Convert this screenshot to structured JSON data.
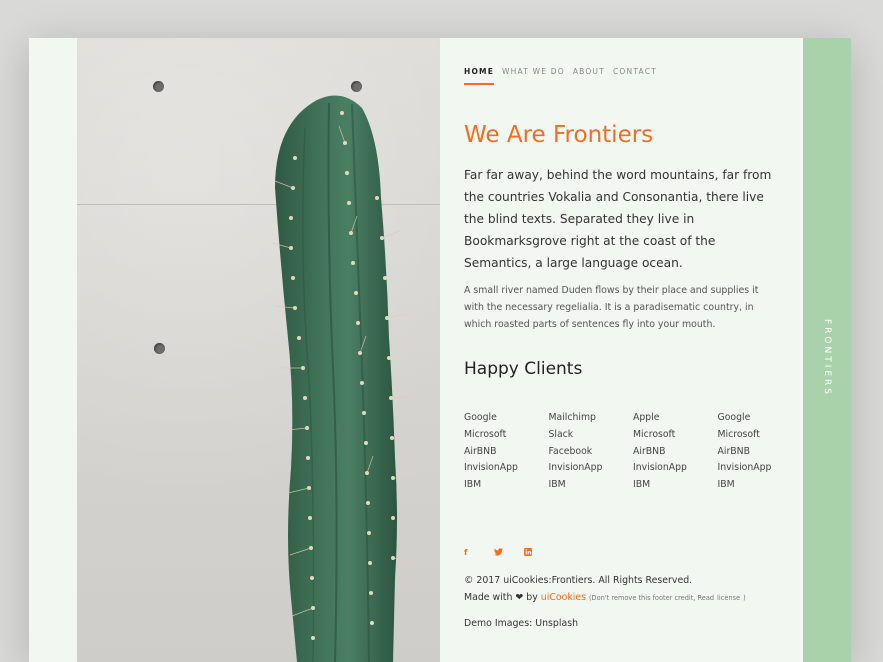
{
  "nav": {
    "items": [
      {
        "label": "HOME",
        "active": true
      },
      {
        "label": "WHAT WE DO",
        "active": false
      },
      {
        "label": "ABOUT",
        "active": false
      },
      {
        "label": "CONTACT",
        "active": false
      }
    ]
  },
  "hero": {
    "title": "We Are Frontiers",
    "lead": "Far far away, behind the word mountains, far from the countries Vokalia and Consonantia, there live the blind texts. Separated they live in Bookmarksgrove right at the coast of the Semantics, a large language ocean.",
    "body": "A small river named Duden flows by their place and supplies it with the necessary regelialia. It is a paradisematic country, in which roasted parts of sentences fly into your mouth."
  },
  "clients": {
    "heading": "Happy Clients",
    "columns": [
      [
        "Google",
        "Microsoft",
        "AirBNB",
        "InvisionApp",
        "IBM"
      ],
      [
        "Mailchimp",
        "Slack",
        "Facebook",
        "InvisionApp",
        "IBM"
      ],
      [
        "Apple",
        "Microsoft",
        "AirBNB",
        "InvisionApp",
        "IBM"
      ],
      [
        "Google",
        "Microsoft",
        "AirBNB",
        "InvisionApp",
        "IBM"
      ]
    ]
  },
  "social": {
    "icons": [
      {
        "name": "facebook-icon",
        "glyph": "f"
      },
      {
        "name": "twitter-icon",
        "glyph": "🐦"
      },
      {
        "name": "linkedin-icon",
        "glyph": "in"
      }
    ]
  },
  "footer": {
    "copyright": "© 2017 uiCookies:Frontiers. All Rights Reserved.",
    "made_with_prefix": "Made with",
    "heart": "❤",
    "by": "by",
    "brand": "uiCookies",
    "credit_note_prefix": "(Don't remove this footer credit, Read",
    "license_link": "license",
    "credit_note_suffix": ")",
    "demo_images": "Demo Images: Unsplash"
  },
  "side": {
    "label": "FRONTIERS"
  },
  "colors": {
    "accent": "#f26d1f",
    "side_bar": "#a9d2aa",
    "panel_bg": "#f2f8f1"
  }
}
